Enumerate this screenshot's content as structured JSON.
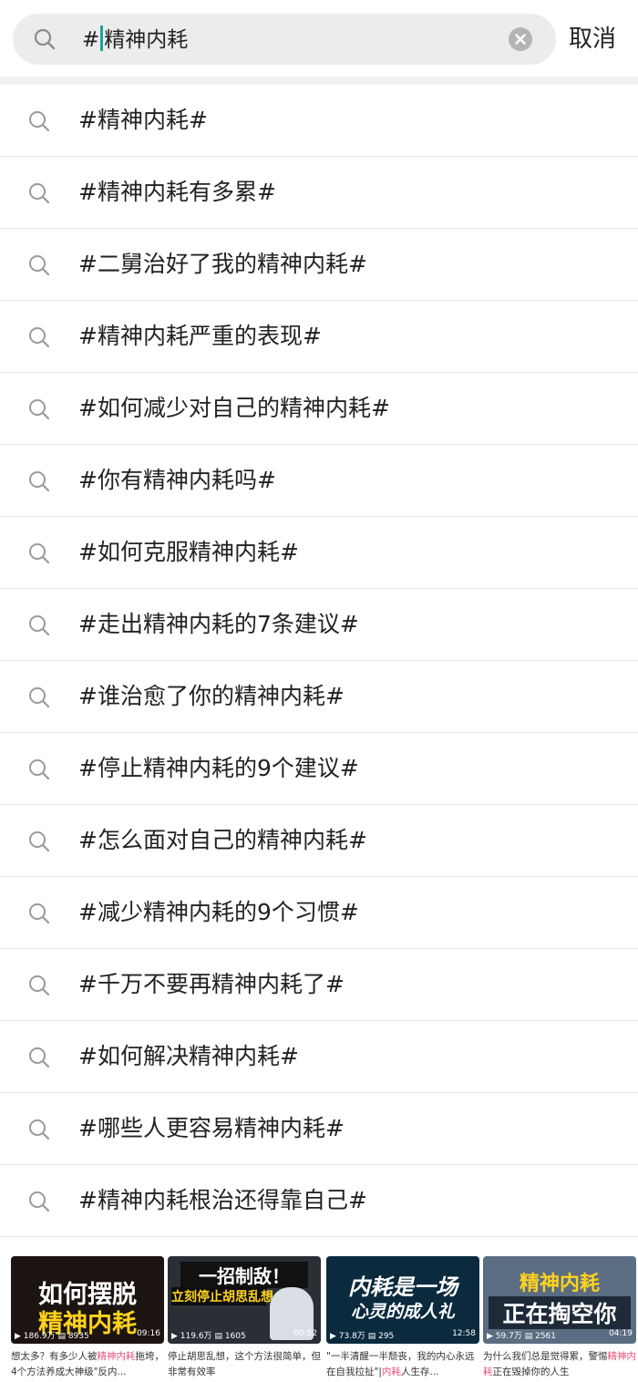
{
  "search": {
    "query_prefix": "#",
    "query_rest": "精神内耗",
    "cancel_label": "取消"
  },
  "suggestions": [
    "#精神内耗#",
    "#精神内耗有多累#",
    "#二舅治好了我的精神内耗#",
    "#精神内耗严重的表现#",
    "#如何减少对自己的精神内耗#",
    "#你有精神内耗吗#",
    "#如何克服精神内耗#",
    "#走出精神内耗的7条建议#",
    "#谁治愈了你的精神内耗#",
    "#停止精神内耗的9个建议#",
    "#怎么面对自己的精神内耗#",
    "#减少精神内耗的9个习惯#",
    "#千万不要再精神内耗了#",
    "#如何解决精神内耗#",
    "#哪些人更容易精神内耗#",
    "#精神内耗根治还得靠自己#"
  ],
  "videos": [
    {
      "thumb_line1": "如何摆脱",
      "thumb_line2": "精神内耗",
      "plays": "186.9万",
      "comments": "8935",
      "duration": "09:16",
      "desc_a": "想太多？有多少人被",
      "desc_hl": "精神内耗",
      "desc_b": "拖垮，4个方法养成大神级\"反内..."
    },
    {
      "thumb_line1": "一招制敌！",
      "thumb_line2": "立刻停止胡思乱想",
      "plays": "119.6万",
      "comments": "1605",
      "duration": "00:52",
      "desc_a": "停止胡思乱想，这个方法很简单，但非常有效率",
      "desc_hl": "",
      "desc_b": ""
    },
    {
      "thumb_line1": "内耗是一场",
      "thumb_line2": "心灵的成人礼",
      "plays": "73.8万",
      "comments": "295",
      "duration": "12:58",
      "desc_a": "\"一半清醒一半颓丧，我的内心永远在自我拉扯\"|",
      "desc_hl": "内耗",
      "desc_b": "人生存..."
    },
    {
      "thumb_line1": "精神内耗",
      "thumb_line2": "正在掏空你",
      "plays": "59.7万",
      "comments": "2561",
      "duration": "04:19",
      "desc_a": "为什么我们总是觉得累，警惕",
      "desc_hl": "精神内耗",
      "desc_b": "正在毁掉你的人生"
    }
  ]
}
